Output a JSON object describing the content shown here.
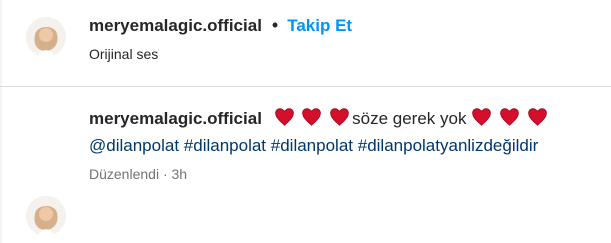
{
  "header": {
    "username": "meryemalagic.official",
    "separator": "•",
    "follow_label": "Takip Et",
    "audio_label": "Orijinal ses"
  },
  "comment": {
    "username": "meryemalagic.official",
    "text_before_hearts": "söze gerek yok",
    "mentions": [
      "@dilanpolat",
      "#dilanpolat",
      "#dilanpolat",
      "#dilanpolatyanlizdeğildir"
    ],
    "meta": "Düzenlendi · 3h",
    "heart_color": "#d30f2b"
  },
  "colors": {
    "link_blue": "#0095f6",
    "hashtag_blue": "#00376b",
    "muted": "#737373"
  },
  "icons": {
    "heart": "red-heart-icon"
  }
}
